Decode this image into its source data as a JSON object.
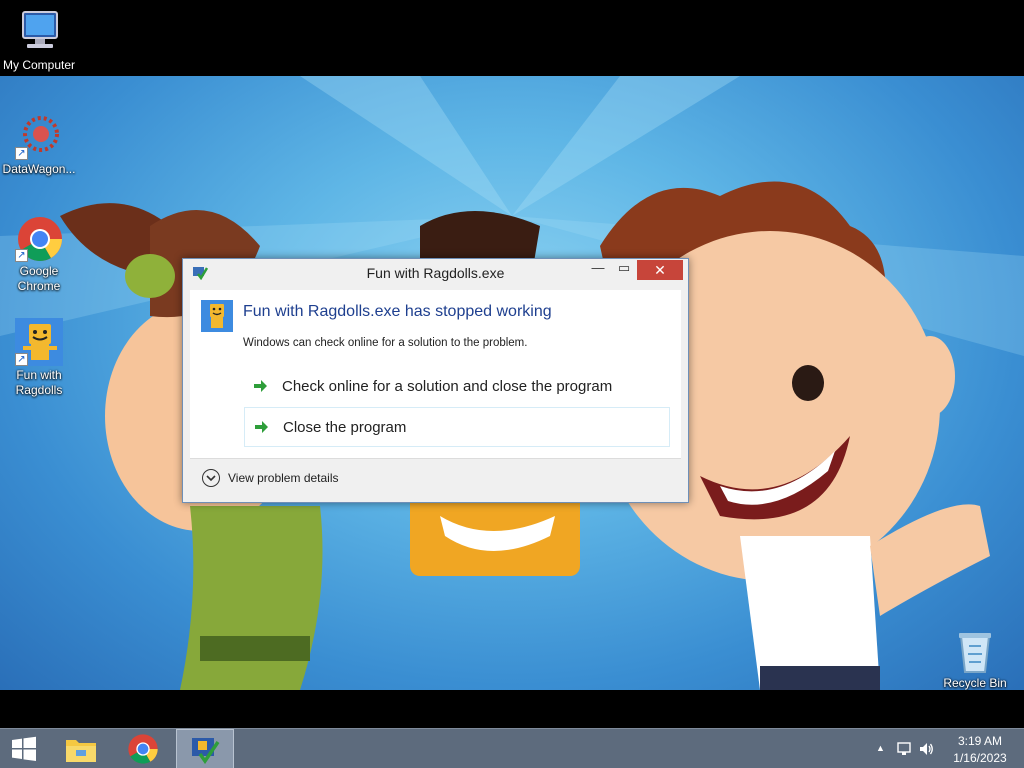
{
  "desktop": {
    "icons": [
      {
        "label": "My Computer"
      },
      {
        "label": "DataWagon..."
      },
      {
        "label": "Google Chrome"
      },
      {
        "label": "Fun with Ragdolls"
      },
      {
        "label": "Recycle Bin"
      }
    ]
  },
  "dialog": {
    "title": "Fun with Ragdolls.exe",
    "heading": "Fun with Ragdolls.exe has stopped working",
    "subtext": "Windows can check online for a solution to the problem.",
    "options": [
      {
        "label": "Check online for a solution and close the program"
      },
      {
        "label": "Close the program"
      }
    ],
    "details_label": "View problem details",
    "close_glyph": "✕",
    "minimize_glyph": "—",
    "maximize_glyph": "▭"
  },
  "taskbar": {
    "items": [
      "start-button",
      "file-explorer",
      "google-chrome",
      "fun-with-ragdolls"
    ],
    "tray": {
      "time": "3:19 AM",
      "date": "1/16/2023"
    }
  },
  "colors": {
    "close_button": "#c7453a",
    "heading_blue": "#1e3f8f",
    "taskbar": "#5d6b7d",
    "arrow_green": "#2e9e3a"
  }
}
